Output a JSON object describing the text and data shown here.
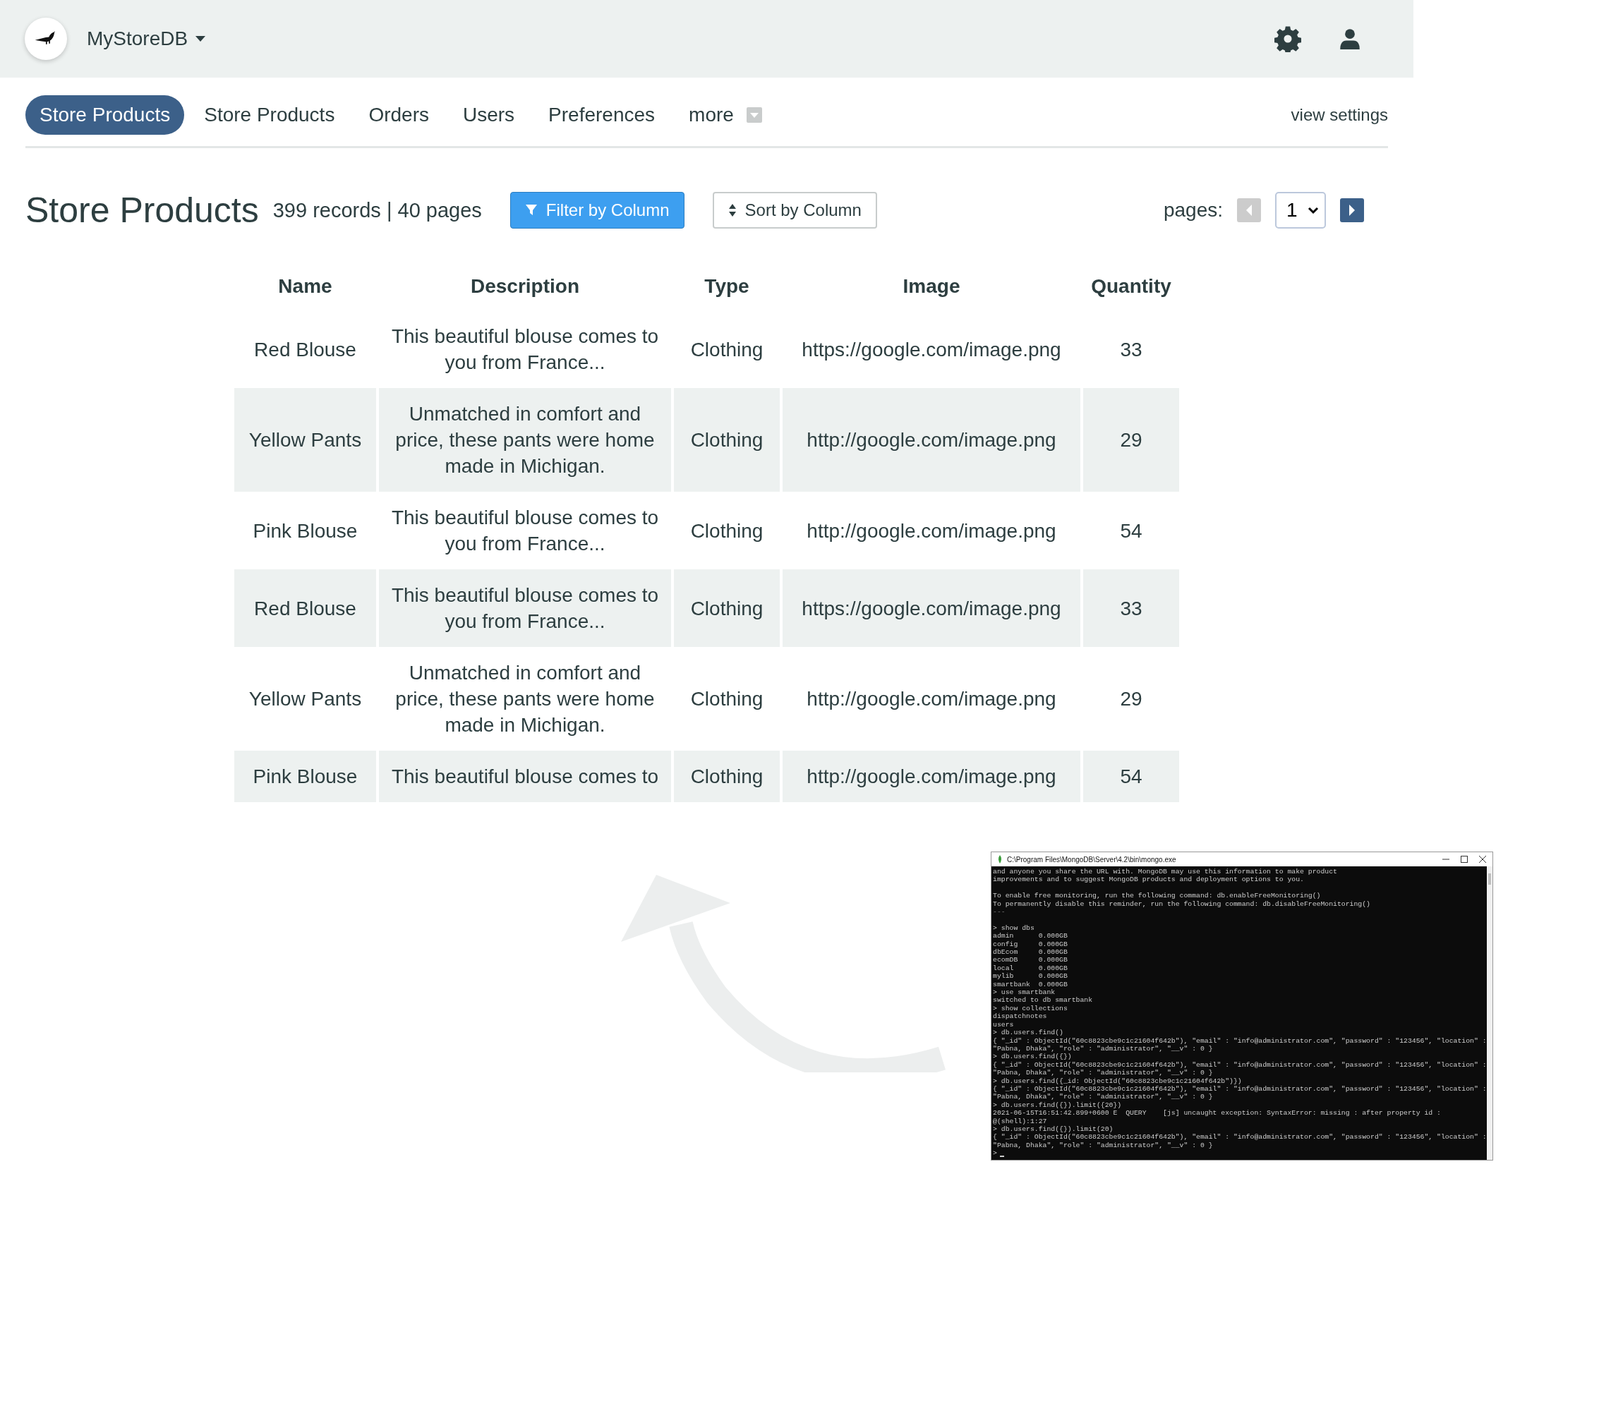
{
  "header": {
    "app_name": "MyStoreDB"
  },
  "tabs": [
    {
      "label": "Store Products",
      "selected": true
    },
    {
      "label": "Store Products",
      "selected": false
    },
    {
      "label": "Orders",
      "selected": false
    },
    {
      "label": "Users",
      "selected": false
    },
    {
      "label": "Preferences",
      "selected": false
    },
    {
      "label": "more",
      "selected": false
    }
  ],
  "view_settings": "view settings",
  "page_title": "Store Products",
  "summary": "399 records | 40 pages",
  "filter_button": "Filter by Column",
  "sort_button": "Sort by Column",
  "pagination": {
    "label": "pages:",
    "prev_disabled": true,
    "current": "1"
  },
  "table": {
    "columns": [
      "Name",
      "Description",
      "Type",
      "Image",
      "Quantity"
    ],
    "rows": [
      {
        "cells": [
          "Red Blouse",
          "This beautiful blouse comes to you from France...",
          "Clothing",
          "https://google.com/image.png",
          "33"
        ]
      },
      {
        "cells": [
          "Yellow Pants",
          "Unmatched in comfort and price, these pants were home made in Michigan.",
          "Clothing",
          "http://google.com/image.png",
          "29"
        ]
      },
      {
        "cells": [
          "Pink Blouse",
          "This beautiful blouse comes to you from France...",
          "Clothing",
          "http://google.com/image.png",
          "54"
        ]
      },
      {
        "cells": [
          "Red Blouse",
          "This beautiful blouse comes to you from France...",
          "Clothing",
          "https://google.com/image.png",
          "33"
        ]
      },
      {
        "cells": [
          "Yellow Pants",
          "Unmatched in comfort and price, these pants were home made in Michigan.",
          "Clothing",
          "http://google.com/image.png",
          "29"
        ]
      },
      {
        "cells": [
          "Pink Blouse",
          "This beautiful blouse comes to",
          "Clothing",
          "http://google.com/image.png",
          "54"
        ]
      }
    ]
  },
  "terminal": {
    "title": "C:\\Program Files\\MongoDB\\Server\\4.2\\bin\\mongo.exe",
    "blocks": [
      {
        "lines": [
          {
            "kind": "out",
            "text": "and anyone you share the URL with. MongoDB may use this information to make product"
          },
          {
            "kind": "out",
            "text": "improvements and to suggest MongoDB products and deployment options to you."
          }
        ]
      },
      {
        "lines": [
          {
            "kind": "out",
            "text": "To enable free monitoring, run the following command: db.enableFreeMonitoring()"
          },
          {
            "kind": "out",
            "text": "To permanently disable this reminder, run the following command: db.disableFreeMonitoring()"
          },
          {
            "kind": "dim",
            "text": "---"
          }
        ]
      },
      {
        "lines": [
          {
            "kind": "out",
            "text": "> show dbs"
          },
          {
            "kind": "out",
            "text": "admin      0.000GB"
          },
          {
            "kind": "out",
            "text": "config     0.000GB"
          },
          {
            "kind": "out",
            "text": "dbEcom     0.000GB"
          },
          {
            "kind": "out",
            "text": "ecomDB     0.000GB"
          },
          {
            "kind": "out",
            "text": "local      0.000GB"
          },
          {
            "kind": "out",
            "text": "mylib      0.000GB"
          },
          {
            "kind": "out",
            "text": "smartbank  0.000GB"
          },
          {
            "kind": "out",
            "text": "> use smartbank"
          },
          {
            "kind": "out",
            "text": "switched to db smartbank"
          },
          {
            "kind": "out",
            "text": "> show collections"
          },
          {
            "kind": "out",
            "text": "dispatchnotes"
          },
          {
            "kind": "out",
            "text": "users"
          },
          {
            "kind": "out",
            "text": "> db.users.find()"
          },
          {
            "kind": "out",
            "text": "{ \"_id\" : ObjectId(\"60c8823cbe9c1c21604f642b\"), \"email\" : \"info@administrator.com\", \"password\" : \"123456\", \"location\" :"
          },
          {
            "kind": "out",
            "text": "\"Pabna, Dhaka\", \"role\" : \"administrator\", \"__v\" : 0 }"
          },
          {
            "kind": "out",
            "text": "> db.users.find({})"
          },
          {
            "kind": "out",
            "text": "{ \"_id\" : ObjectId(\"60c8823cbe9c1c21604f642b\"), \"email\" : \"info@administrator.com\", \"password\" : \"123456\", \"location\" :"
          },
          {
            "kind": "out",
            "text": "\"Pabna, Dhaka\", \"role\" : \"administrator\", \"__v\" : 0 }"
          },
          {
            "kind": "out",
            "text": "> db.users.find({_id: ObjectId(\"60c8823cbe9c1c21604f642b\")})"
          },
          {
            "kind": "out",
            "text": "{ \"_id\" : ObjectId(\"60c8823cbe9c1c21604f642b\"), \"email\" : \"info@administrator.com\", \"password\" : \"123456\", \"location\" :"
          },
          {
            "kind": "out",
            "text": "\"Pabna, Dhaka\", \"role\" : \"administrator\", \"__v\" : 0 }"
          },
          {
            "kind": "out",
            "text": "> db.users.find({}).limit({20})"
          },
          {
            "kind": "out",
            "text": "2021-06-15T16:51:42.899+0600 E  QUERY    [js] uncaught exception: SyntaxError: missing : after property id :"
          },
          {
            "kind": "out",
            "text": "@(shell):1:27"
          },
          {
            "kind": "out",
            "text": "> db.users.find({}).limit(20)"
          },
          {
            "kind": "out",
            "text": "{ \"_id\" : ObjectId(\"60c8823cbe9c1c21604f642b\"), \"email\" : \"info@administrator.com\", \"password\" : \"123456\", \"location\" :"
          },
          {
            "kind": "out",
            "text": "\"Pabna, Dhaka\", \"role\" : \"administrator\", \"__v\" : 0 }"
          },
          {
            "kind": "out",
            "text": ">"
          }
        ]
      }
    ]
  }
}
